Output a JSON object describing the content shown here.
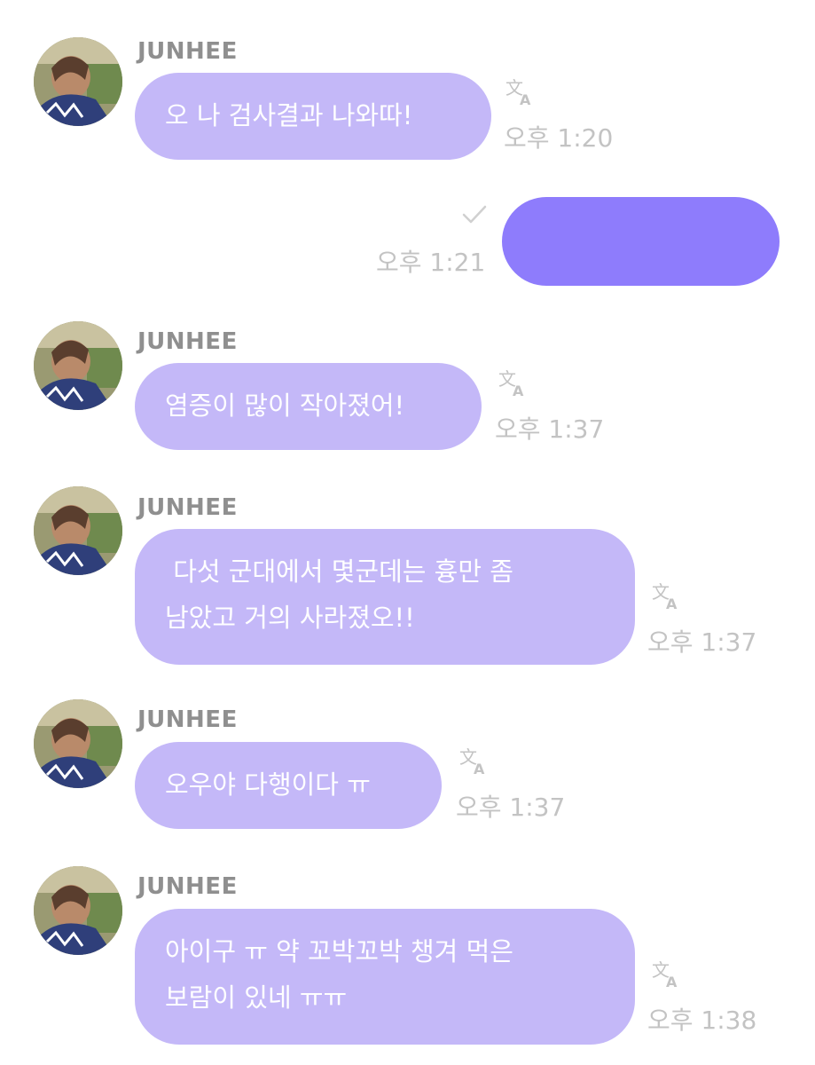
{
  "messages": [
    {
      "sender": "JUNHEE",
      "text": "오 나 검사결과 나와따!",
      "time": "오후 1:20",
      "icon": "translate-icon"
    },
    {
      "sender": "",
      "text": "",
      "time": "오후 1:21",
      "icon": "read-check-icon",
      "outgoing": true
    },
    {
      "sender": "JUNHEE",
      "text": "염증이 많이 작아졌어!",
      "time": "오후 1:37",
      "icon": "translate-icon"
    },
    {
      "sender": "JUNHEE",
      "text": " 다섯 군대에서 몇군데는 흉만 좀\n남았고 거의 사라졌오!!",
      "time": "오후 1:37",
      "icon": "translate-icon"
    },
    {
      "sender": "JUNHEE",
      "text": "오우야 다행이다 ㅠ",
      "time": "오후 1:37",
      "icon": "translate-icon"
    },
    {
      "sender": "JUNHEE",
      "text": "아이구 ㅠ 약 꼬박꼬박 챙겨 먹은\n보람이 있네 ㅠㅠ",
      "time": "오후 1:38",
      "icon": "translate-icon"
    }
  ],
  "colors": {
    "incoming_bubble": "#c4b8f8",
    "outgoing_bubble": "#8e7cfc",
    "sender_name": "#8f8f8f",
    "timestamp": "#c3c3c3"
  }
}
